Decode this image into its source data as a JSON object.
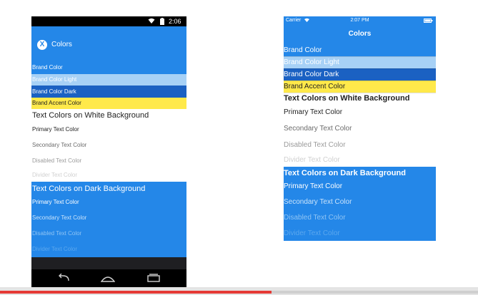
{
  "colors": {
    "brand": "#2487e8",
    "brand_light": "#a7d1f6",
    "brand_dark": "#1b61c2",
    "accent": "#ffe94a",
    "white_bg": "#ffffff",
    "text_primary_on_white": "#222222",
    "text_secondary_on_white": "#6b6b6b",
    "text_disabled_on_white": "#9b9b9b",
    "text_divider_on_white": "#d0d0d0",
    "text_primary_on_dark": "#ffffff",
    "text_secondary_on_dark": "#c9e3fb",
    "text_disabled_on_dark": "#8fc4f4",
    "text_divider_on_dark": "#5aa7ee"
  },
  "android": {
    "status": {
      "time": "2:06",
      "icons": [
        "wifi-icon",
        "battery-icon"
      ]
    },
    "appbar": {
      "logo_glyph": "X",
      "title": "Colors"
    },
    "nav": {
      "back_icon": "back-icon",
      "home_icon": "home-icon",
      "recents_icon": "recents-icon"
    }
  },
  "ios": {
    "status": {
      "carrier": "Carrier",
      "time": "2:07 PM",
      "icons": [
        "wifi-icon",
        "battery-icon"
      ]
    },
    "navbar": {
      "title": "Colors"
    }
  },
  "list": {
    "brand_color": "Brand Color",
    "brand_color_light": "Brand Color Light",
    "brand_color_dark": "Brand Color Dark",
    "brand_accent_color": "Brand Accent Color",
    "header_white": "Text Colors on White Background",
    "primary_text": "Primary Text Color",
    "secondary_text": "Secondary Text Color",
    "disabled_text": "Disabled Text Color",
    "divider_text": "Divider Text Color",
    "header_dark": "Text Colors on Dark Background"
  },
  "video": {
    "progress": 0.568
  }
}
